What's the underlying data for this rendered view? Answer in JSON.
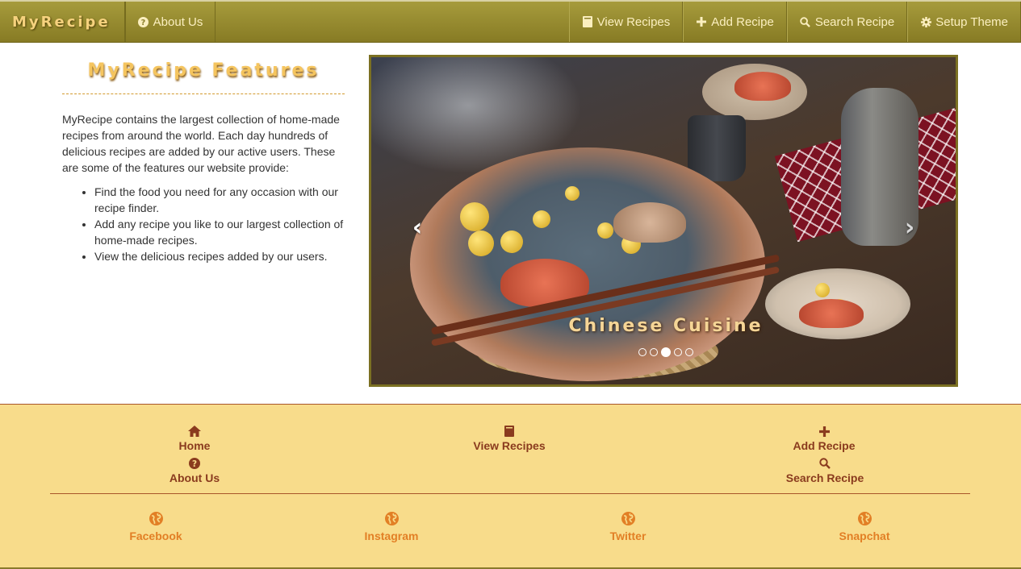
{
  "navbar": {
    "brand": "MyRecipe",
    "about": {
      "label": "About Us",
      "icon": "question-circle-icon"
    },
    "right": [
      {
        "label": "View Recipes",
        "icon": "book-icon"
      },
      {
        "label": "Add Recipe",
        "icon": "plus-icon"
      },
      {
        "label": "Search Recipe",
        "icon": "search-icon"
      },
      {
        "label": "Setup Theme",
        "icon": "gear-icon"
      }
    ]
  },
  "features": {
    "title": "MyRecipe Features",
    "description": "MyRecipe contains the largest collection of home-made recipes from around the world. Each day hundreds of delicious recipes are added by our active users. These are some of the features our website provide:",
    "items": [
      "Find the food you need for any occasion with our recipe finder.",
      "Add any recipe you like to our largest collection of home-made recipes.",
      "View the delicious recipes added by our users."
    ]
  },
  "carousel": {
    "caption": "Chinese Cuisine",
    "prev_glyph": "‹",
    "next_glyph": "›",
    "slide_count": 5,
    "active_index": 2
  },
  "footer": {
    "links": [
      {
        "label": "Home",
        "icon": "home-icon"
      },
      {
        "label": "View Recipes",
        "icon": "book-icon"
      },
      {
        "label": "Add Recipe",
        "icon": "plus-icon"
      },
      {
        "label": "About Us",
        "icon": "question-circle-icon"
      },
      {
        "label": "Search Recipe",
        "icon": "search-icon"
      }
    ],
    "social": [
      {
        "label": "Facebook",
        "icon": "globe-icon"
      },
      {
        "label": "Instagram",
        "icon": "globe-icon"
      },
      {
        "label": "Twitter",
        "icon": "globe-icon"
      },
      {
        "label": "Snapchat",
        "icon": "globe-icon"
      }
    ]
  },
  "colors": {
    "navbar": "#a69b3c",
    "brand_text": "#f6d27e",
    "footer_bg": "#f8dc8b",
    "footer_link": "#8a3b1e",
    "social_link": "#e27f25"
  }
}
